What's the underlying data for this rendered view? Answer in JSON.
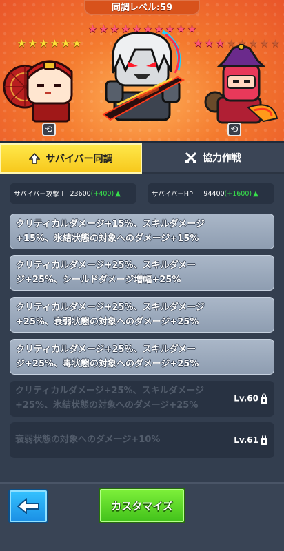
{
  "header": {
    "sync_level": "同調レベル:59"
  },
  "characters": [
    {
      "name": "red-samurai-girl",
      "stars": [
        "yellow",
        "yellow",
        "yellow",
        "yellow",
        "yellow",
        "yellow"
      ]
    },
    {
      "name": "white-haired-warrior",
      "stars": [
        "pink",
        "pink",
        "pink",
        "pink",
        "pink",
        "pink",
        "pink",
        "pink",
        "pink",
        "pink"
      ]
    },
    {
      "name": "purple-hat-gunner",
      "stars": [
        "pink",
        "pink",
        "pink",
        "gray",
        "gray",
        "gray",
        "gray",
        "gray"
      ]
    }
  ],
  "tabs": {
    "survivor_sync": "サバイバー同調",
    "cooperation": "協力作戦"
  },
  "stats": {
    "attack": {
      "label": "サバイバー攻撃＋",
      "value": "23600",
      "plus": "(+400)"
    },
    "hp": {
      "label": "サバイバーHP＋",
      "value": "94400",
      "plus": "(+1600)"
    }
  },
  "effects": [
    {
      "line1": "クリティカルダメージ+15%、スキルダメージ",
      "line2": "+15%、氷結状態の対象へのダメージ+15%",
      "locked": false
    },
    {
      "line1": "クリティカルダメージ+25%、スキルダメー",
      "line2": "ジ+25%、シールドダメージ増幅+25%",
      "locked": false
    },
    {
      "line1": "クリティカルダメージ+25%、スキルダメージ",
      "line2": "+25%、衰弱状態の対象へのダメージ+25%",
      "locked": false
    },
    {
      "line1": "クリティカルダメージ+25%、スキルダメー",
      "line2": "ジ+25%、毒状態の対象へのダメージ+25%",
      "locked": false
    },
    {
      "line1": "クリティカルダメージ+25%、スキルダメージ",
      "line2": "+25%、氷結状態の対象へのダメージ+25%",
      "locked": true,
      "level": "Lv.60"
    },
    {
      "line1": "衰弱状態の対象へのダメージ+10%",
      "line2": "",
      "locked": true,
      "level": "Lv.61"
    }
  ],
  "buttons": {
    "customize": "カスタマイズ"
  },
  "colors": {
    "accent_yellow": "#f7c81c",
    "green_bonus": "#37e04b",
    "back_blue": "#1a8ee4",
    "customize_green": "#41c11a"
  }
}
